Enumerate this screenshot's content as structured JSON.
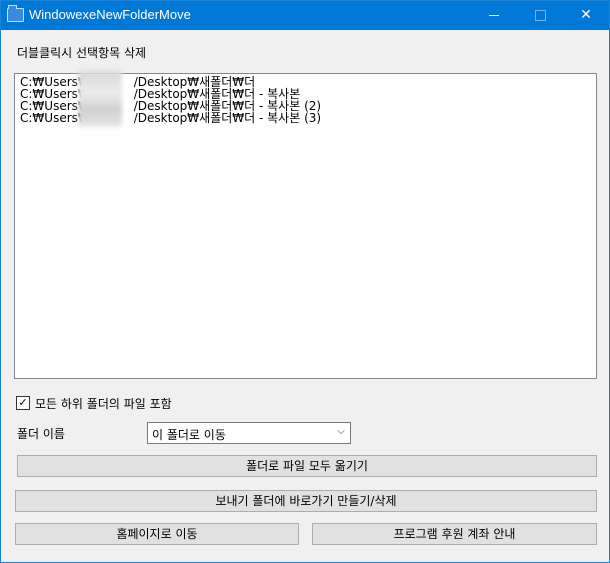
{
  "window": {
    "title": "WindowexeNewFolderMove",
    "icon": "folder-icon",
    "controls": {
      "minimize": "minimize-icon",
      "maximize": "maximize-icon",
      "close": "close-icon"
    }
  },
  "header": {
    "label": "더블클릭시 선택항목 삭제"
  },
  "list": {
    "items": [
      "C:₩Users₩",
      "C:₩Users₩",
      "C:₩Users₩",
      "C:₩Users₩"
    ],
    "suffixes": [
      "/Desktop₩새폴더₩더",
      "/Desktop₩새폴더₩더 - 복사본",
      "/Desktop₩새폴더₩더 - 복사본 (2)",
      "/Desktop₩새폴더₩더 - 복사본 (3)"
    ]
  },
  "options": {
    "include_subfolders_label": "모든 하위 폴더의 파일 포함",
    "include_subfolders_checked": true,
    "checkmark": "✓"
  },
  "folder": {
    "label": "폴더 이름",
    "selected": "이 폴더로 이동",
    "chevron": "⌵"
  },
  "buttons": {
    "move_all": "폴더로 파일 모두 옮기기",
    "sendto_shortcut": "보내기 폴더에 바로가기 만들기/삭제",
    "homepage": "홈페이지로 이동",
    "donate": "프로그램 후원 계좌 안내"
  },
  "titlebar_glyphs": {
    "close": "✕"
  }
}
